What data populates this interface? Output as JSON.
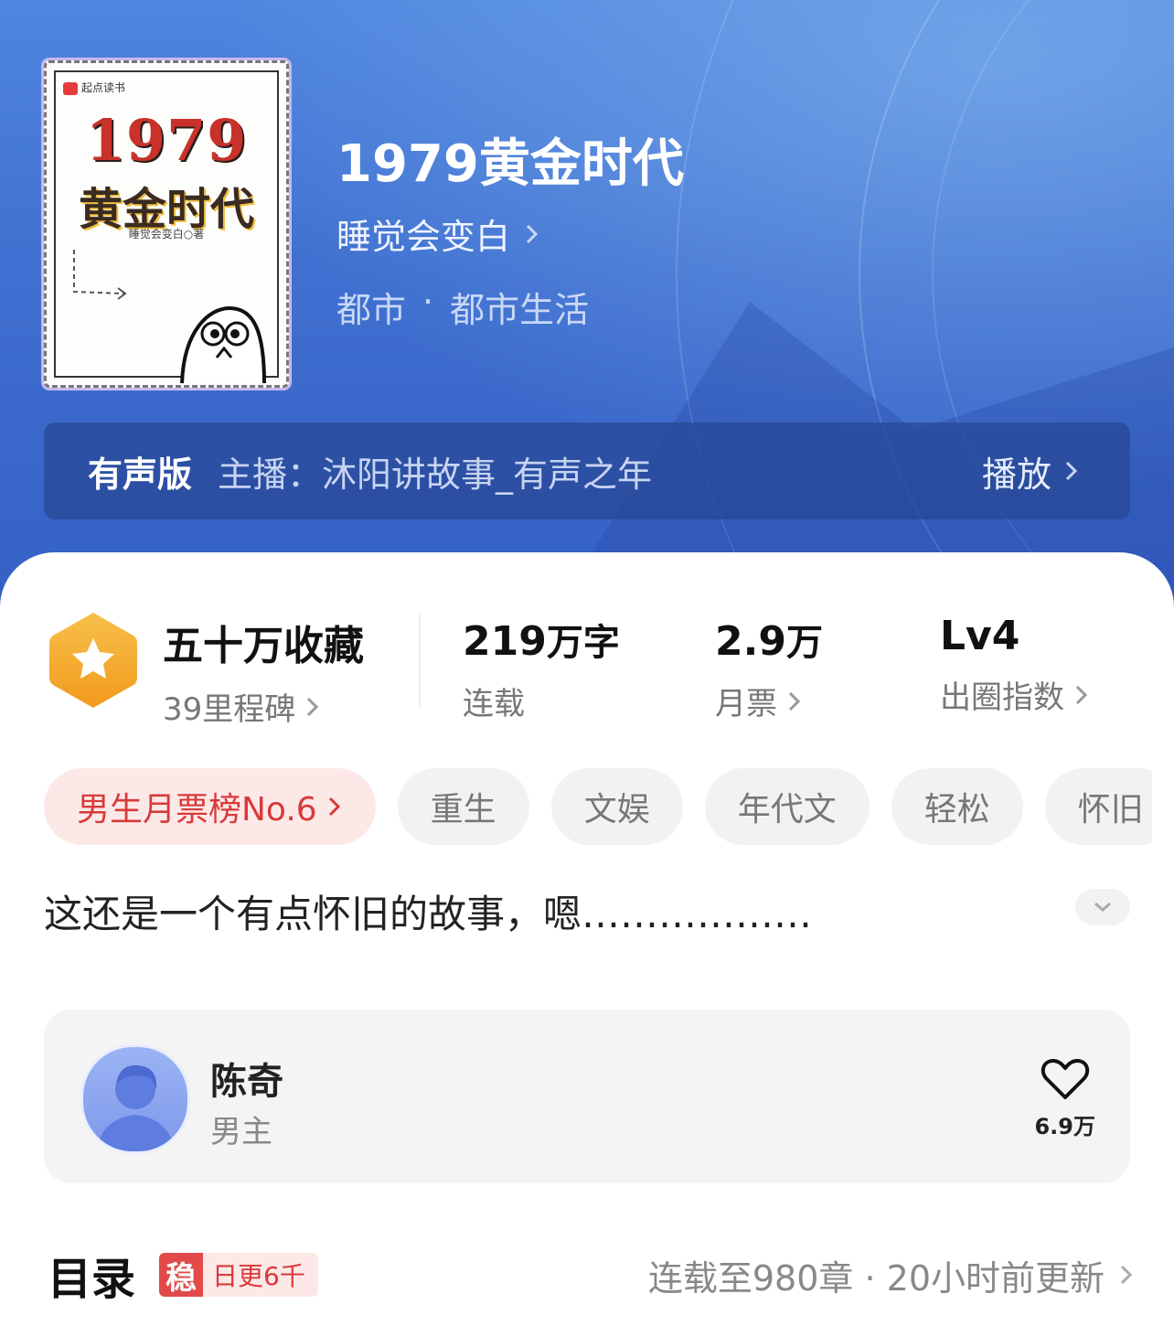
{
  "book": {
    "cover": {
      "brand": "起点读书",
      "title_line1": "1979",
      "title_line2": "黄金时代",
      "author_line": "睡觉会变白○著"
    },
    "title": "1979黄金时代",
    "author": "睡觉会变白",
    "genre": "都市",
    "genre_sep": "·",
    "subgenre": "都市生活"
  },
  "audio": {
    "label": "有声版",
    "host": "主播：沐阳讲故事_有声之年",
    "play_label": "播放"
  },
  "stats": {
    "collection": {
      "value": "五十万收藏",
      "sub": "39里程碑"
    },
    "words": {
      "value": "219",
      "unit": "万字",
      "sub": "连载"
    },
    "tickets": {
      "value": "2.9",
      "unit": "万",
      "sub": "月票"
    },
    "influence": {
      "value": "Lv4",
      "sub": "出圈指数"
    }
  },
  "tags": {
    "rank": "男生月票榜No.6",
    "items": [
      "重生",
      "文娱",
      "年代文",
      "轻松",
      "怀旧"
    ]
  },
  "description": "这还是一个有点怀旧的故事，嗯………………",
  "character": {
    "name": "陈奇",
    "role": "男主",
    "likes": "6.9万"
  },
  "toc": {
    "title": "目录",
    "badge_icon": "稳",
    "badge_text": "日更6千",
    "status": "连载至980章 · 20小时前更新"
  },
  "icons": {
    "star_badge": "star-hexagon-icon",
    "chevron": "chevron-right-icon",
    "heart": "heart-icon",
    "expand": "chevron-down-icon"
  },
  "colors": {
    "hero_blue": "#3f6fd0",
    "badge_orange": "#f5a623",
    "rank_red": "#d83a3a"
  }
}
